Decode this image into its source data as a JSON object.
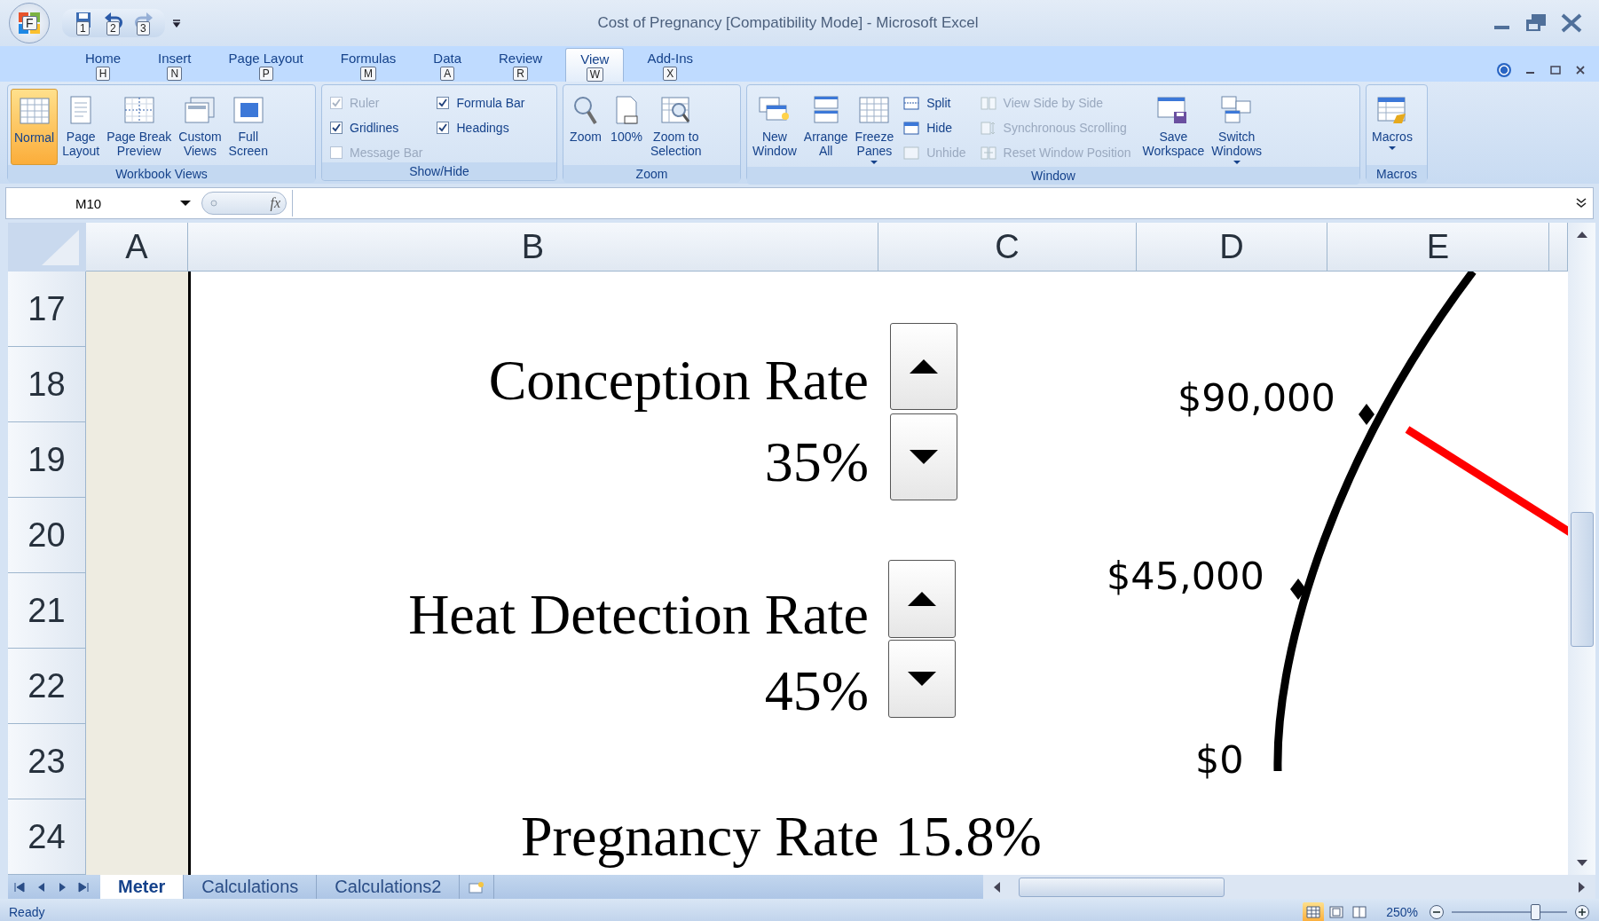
{
  "window": {
    "title": "Cost of Pregnancy  [Compatibility Mode] - Microsoft Excel",
    "app_button_keytip": "F"
  },
  "quick_access": [
    {
      "keytip": "1",
      "disabled": false
    },
    {
      "keytip": "2",
      "disabled": false
    },
    {
      "keytip": "3",
      "disabled": true
    }
  ],
  "tabs": [
    {
      "label": "Home",
      "keytip": "H",
      "selected": false
    },
    {
      "label": "Insert",
      "keytip": "N",
      "selected": false
    },
    {
      "label": "Page Layout",
      "keytip": "P",
      "selected": false
    },
    {
      "label": "Formulas",
      "keytip": "M",
      "selected": false
    },
    {
      "label": "Data",
      "keytip": "A",
      "selected": false
    },
    {
      "label": "Review",
      "keytip": "R",
      "selected": false
    },
    {
      "label": "View",
      "keytip": "W",
      "selected": true
    },
    {
      "label": "Add-Ins",
      "keytip": "X",
      "selected": false
    }
  ],
  "ribbon": {
    "groups": [
      {
        "name": "Workbook Views",
        "items": [
          {
            "kind": "large",
            "label": "Normal",
            "selected": true
          },
          {
            "kind": "large",
            "label": "Page\nLayout",
            "selected": false
          },
          {
            "kind": "large",
            "label": "Page Break\nPreview",
            "selected": false
          },
          {
            "kind": "large",
            "label": "Custom\nViews",
            "selected": false
          },
          {
            "kind": "large",
            "label": "Full\nScreen",
            "selected": false
          }
        ]
      },
      {
        "name": "Show/Hide",
        "items": [
          {
            "kind": "check",
            "label": "Ruler",
            "checked": true,
            "disabled": true
          },
          {
            "kind": "check",
            "label": "Gridlines",
            "checked": true,
            "disabled": false
          },
          {
            "kind": "check",
            "label": "Message Bar",
            "checked": false,
            "disabled": true
          },
          {
            "kind": "check",
            "label": "Formula Bar",
            "checked": true,
            "disabled": false
          },
          {
            "kind": "check",
            "label": "Headings",
            "checked": true,
            "disabled": false
          }
        ]
      },
      {
        "name": "Zoom",
        "items": [
          {
            "kind": "large",
            "label": "Zoom",
            "selected": false
          },
          {
            "kind": "large",
            "label": "100%",
            "selected": false
          },
          {
            "kind": "large",
            "label": "Zoom to\nSelection",
            "selected": false
          }
        ]
      },
      {
        "name": "Window",
        "items": [
          {
            "kind": "large",
            "label": "New\nWindow",
            "selected": false
          },
          {
            "kind": "large",
            "label": "Arrange\nAll",
            "selected": false
          },
          {
            "kind": "large",
            "label": "Freeze\nPanes",
            "selected": false,
            "dropdown": true
          },
          {
            "kind": "small",
            "label": "Split",
            "disabled": false
          },
          {
            "kind": "small",
            "label": "Hide",
            "disabled": false
          },
          {
            "kind": "small",
            "label": "Unhide",
            "disabled": true
          },
          {
            "kind": "small",
            "label": "View Side by Side",
            "disabled": true
          },
          {
            "kind": "small",
            "label": "Synchronous Scrolling",
            "disabled": true
          },
          {
            "kind": "small",
            "label": "Reset Window Position",
            "disabled": true
          },
          {
            "kind": "large",
            "label": "Save\nWorkspace",
            "selected": false
          },
          {
            "kind": "large",
            "label": "Switch\nWindows",
            "selected": false,
            "dropdown": true
          }
        ]
      },
      {
        "name": "Macros",
        "items": [
          {
            "kind": "large",
            "label": "Macros",
            "selected": false,
            "dropdown": true
          }
        ]
      }
    ]
  },
  "formula_bar": {
    "name_box": "M10",
    "fx": "fx"
  },
  "sheet": {
    "columns": [
      "A",
      "B",
      "C",
      "D",
      "E"
    ],
    "rows": [
      "17",
      "18",
      "19",
      "20",
      "21",
      "22",
      "23",
      "24"
    ],
    "spinners": [
      {
        "label": "Conception Rate",
        "value": "35%"
      },
      {
        "label": "Heat Detection Rate",
        "value": "45%"
      }
    ],
    "result": {
      "label": "Pregnancy Rate",
      "value": "15.8%"
    },
    "gauge": {
      "labels": [
        "$90,000",
        "$45,000",
        "$0"
      ]
    }
  },
  "sheet_tabs": [
    {
      "label": "Meter",
      "selected": true
    },
    {
      "label": "Calculations",
      "selected": false
    },
    {
      "label": "Calculations2",
      "selected": false
    }
  ],
  "status_bar": {
    "text": "Ready",
    "zoom": "250%",
    "views": [
      {
        "selected": true
      },
      {
        "selected": false
      },
      {
        "selected": false
      }
    ],
    "zoom_slider": {
      "level": 0.72
    }
  }
}
